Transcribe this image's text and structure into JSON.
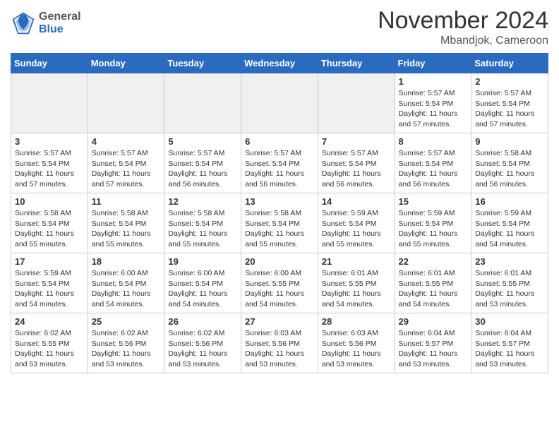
{
  "header": {
    "logo_general": "General",
    "logo_blue": "Blue",
    "month_title": "November 2024",
    "location": "Mbandjok, Cameroon"
  },
  "weekdays": [
    "Sunday",
    "Monday",
    "Tuesday",
    "Wednesday",
    "Thursday",
    "Friday",
    "Saturday"
  ],
  "weeks": [
    [
      {
        "day": "",
        "info": ""
      },
      {
        "day": "",
        "info": ""
      },
      {
        "day": "",
        "info": ""
      },
      {
        "day": "",
        "info": ""
      },
      {
        "day": "",
        "info": ""
      },
      {
        "day": "1",
        "info": "Sunrise: 5:57 AM\nSunset: 5:54 PM\nDaylight: 11 hours\nand 57 minutes."
      },
      {
        "day": "2",
        "info": "Sunrise: 5:57 AM\nSunset: 5:54 PM\nDaylight: 11 hours\nand 57 minutes."
      }
    ],
    [
      {
        "day": "3",
        "info": "Sunrise: 5:57 AM\nSunset: 5:54 PM\nDaylight: 11 hours\nand 57 minutes."
      },
      {
        "day": "4",
        "info": "Sunrise: 5:57 AM\nSunset: 5:54 PM\nDaylight: 11 hours\nand 57 minutes."
      },
      {
        "day": "5",
        "info": "Sunrise: 5:57 AM\nSunset: 5:54 PM\nDaylight: 11 hours\nand 56 minutes."
      },
      {
        "day": "6",
        "info": "Sunrise: 5:57 AM\nSunset: 5:54 PM\nDaylight: 11 hours\nand 56 minutes."
      },
      {
        "day": "7",
        "info": "Sunrise: 5:57 AM\nSunset: 5:54 PM\nDaylight: 11 hours\nand 56 minutes."
      },
      {
        "day": "8",
        "info": "Sunrise: 5:57 AM\nSunset: 5:54 PM\nDaylight: 11 hours\nand 56 minutes."
      },
      {
        "day": "9",
        "info": "Sunrise: 5:58 AM\nSunset: 5:54 PM\nDaylight: 11 hours\nand 56 minutes."
      }
    ],
    [
      {
        "day": "10",
        "info": "Sunrise: 5:58 AM\nSunset: 5:54 PM\nDaylight: 11 hours\nand 55 minutes."
      },
      {
        "day": "11",
        "info": "Sunrise: 5:58 AM\nSunset: 5:54 PM\nDaylight: 11 hours\nand 55 minutes."
      },
      {
        "day": "12",
        "info": "Sunrise: 5:58 AM\nSunset: 5:54 PM\nDaylight: 11 hours\nand 55 minutes."
      },
      {
        "day": "13",
        "info": "Sunrise: 5:58 AM\nSunset: 5:54 PM\nDaylight: 11 hours\nand 55 minutes."
      },
      {
        "day": "14",
        "info": "Sunrise: 5:59 AM\nSunset: 5:54 PM\nDaylight: 11 hours\nand 55 minutes."
      },
      {
        "day": "15",
        "info": "Sunrise: 5:59 AM\nSunset: 5:54 PM\nDaylight: 11 hours\nand 55 minutes."
      },
      {
        "day": "16",
        "info": "Sunrise: 5:59 AM\nSunset: 5:54 PM\nDaylight: 11 hours\nand 54 minutes."
      }
    ],
    [
      {
        "day": "17",
        "info": "Sunrise: 5:59 AM\nSunset: 5:54 PM\nDaylight: 11 hours\nand 54 minutes."
      },
      {
        "day": "18",
        "info": "Sunrise: 6:00 AM\nSunset: 5:54 PM\nDaylight: 11 hours\nand 54 minutes."
      },
      {
        "day": "19",
        "info": "Sunrise: 6:00 AM\nSunset: 5:54 PM\nDaylight: 11 hours\nand 54 minutes."
      },
      {
        "day": "20",
        "info": "Sunrise: 6:00 AM\nSunset: 5:55 PM\nDaylight: 11 hours\nand 54 minutes."
      },
      {
        "day": "21",
        "info": "Sunrise: 6:01 AM\nSunset: 5:55 PM\nDaylight: 11 hours\nand 54 minutes."
      },
      {
        "day": "22",
        "info": "Sunrise: 6:01 AM\nSunset: 5:55 PM\nDaylight: 11 hours\nand 54 minutes."
      },
      {
        "day": "23",
        "info": "Sunrise: 6:01 AM\nSunset: 5:55 PM\nDaylight: 11 hours\nand 53 minutes."
      }
    ],
    [
      {
        "day": "24",
        "info": "Sunrise: 6:02 AM\nSunset: 5:55 PM\nDaylight: 11 hours\nand 53 minutes."
      },
      {
        "day": "25",
        "info": "Sunrise: 6:02 AM\nSunset: 5:56 PM\nDaylight: 11 hours\nand 53 minutes."
      },
      {
        "day": "26",
        "info": "Sunrise: 6:02 AM\nSunset: 5:56 PM\nDaylight: 11 hours\nand 53 minutes."
      },
      {
        "day": "27",
        "info": "Sunrise: 6:03 AM\nSunset: 5:56 PM\nDaylight: 11 hours\nand 53 minutes."
      },
      {
        "day": "28",
        "info": "Sunrise: 6:03 AM\nSunset: 5:56 PM\nDaylight: 11 hours\nand 53 minutes."
      },
      {
        "day": "29",
        "info": "Sunrise: 6:04 AM\nSunset: 5:57 PM\nDaylight: 11 hours\nand 53 minutes."
      },
      {
        "day": "30",
        "info": "Sunrise: 6:04 AM\nSunset: 5:57 PM\nDaylight: 11 hours\nand 53 minutes."
      }
    ]
  ]
}
